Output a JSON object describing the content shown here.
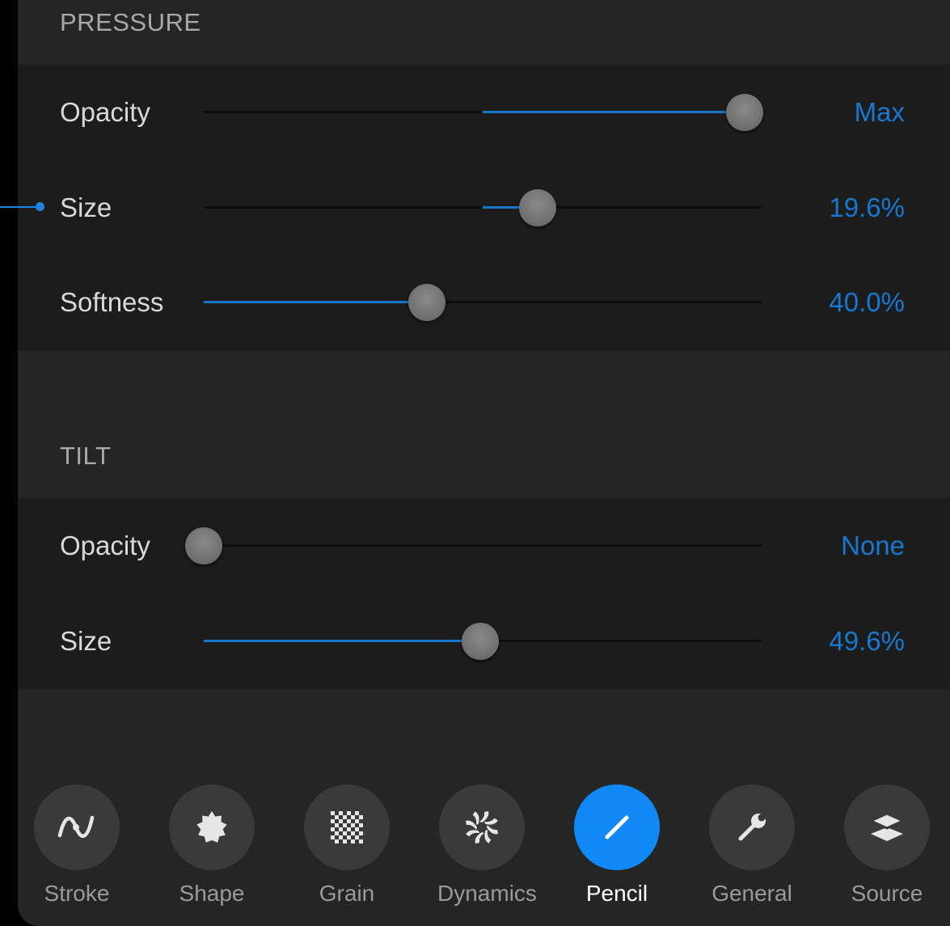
{
  "colors": {
    "accent": "#1877cf",
    "active_tab": "#1088f5",
    "panel_bg": "#252525",
    "group_bg": "#1c1c1c"
  },
  "sections": [
    {
      "title": "PRESSURE",
      "rows": [
        {
          "label": "Opacity",
          "value": "Max",
          "fill_from": 0.5,
          "level": 0.97
        },
        {
          "label": "Size",
          "value": "19.6%",
          "fill_from": 0.5,
          "level": 0.598
        },
        {
          "label": "Softness",
          "value": "40.0%",
          "fill_from": 0.0,
          "level": 0.4
        }
      ]
    },
    {
      "title": "TILT",
      "rows": [
        {
          "label": "Opacity",
          "value": "None",
          "fill_from": 0.0,
          "level": 0.0
        },
        {
          "label": "Size",
          "value": "49.6%",
          "fill_from": 0.0,
          "level": 0.496
        }
      ]
    }
  ],
  "tabs": [
    {
      "label": "Stroke",
      "icon": "stroke-path-icon",
      "active": false
    },
    {
      "label": "Shape",
      "icon": "shape-badge-icon",
      "active": false
    },
    {
      "label": "Grain",
      "icon": "grain-checker-icon",
      "active": false
    },
    {
      "label": "Dynamics",
      "icon": "dynamics-swirl-icon",
      "active": false
    },
    {
      "label": "Pencil",
      "icon": "pencil-icon",
      "active": true
    },
    {
      "label": "General",
      "icon": "wrench-icon",
      "active": false
    },
    {
      "label": "Source",
      "icon": "layers-icon",
      "active": false
    }
  ]
}
